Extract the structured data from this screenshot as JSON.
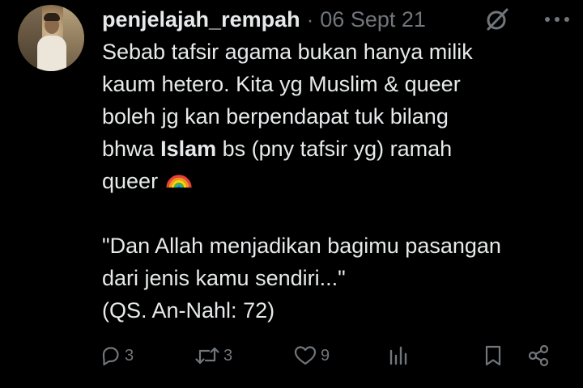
{
  "tweet": {
    "username": "penjelajah_rempah",
    "separator": "·",
    "date": "06 Sept 21",
    "text": {
      "line1": "Sebab tafsir agama bukan hanya milik",
      "line2": "kaum hetero. Kita yg Muslim & queer",
      "line3": "boleh jg kan berpendapat tuk bilang",
      "line4_pre": "bhwa ",
      "line4_bold": "Islam",
      "line4_post": " bs (pny tafsir yg) ramah",
      "line5": "queer",
      "line5_emoji": "rainbow-emoji",
      "quote1": "\"Dan Allah menjadikan bagimu pasangan",
      "quote2": "dari jenis kamu sendiri...\"",
      "quote3": "(QS. An-Nahl: 72)"
    },
    "actions": {
      "reply_count": "3",
      "retweet_count": "3",
      "like_count": "9",
      "views_count": ""
    },
    "icons": {
      "grok": "grok-icon",
      "more": "more-icon",
      "reply": "reply-icon",
      "retweet": "retweet-icon",
      "like": "like-icon",
      "views": "views-icon",
      "bookmark": "bookmark-icon",
      "share": "share-icon"
    },
    "colors": {
      "background": "#000000",
      "text": "#e7e9ea",
      "muted": "#71767b"
    }
  }
}
